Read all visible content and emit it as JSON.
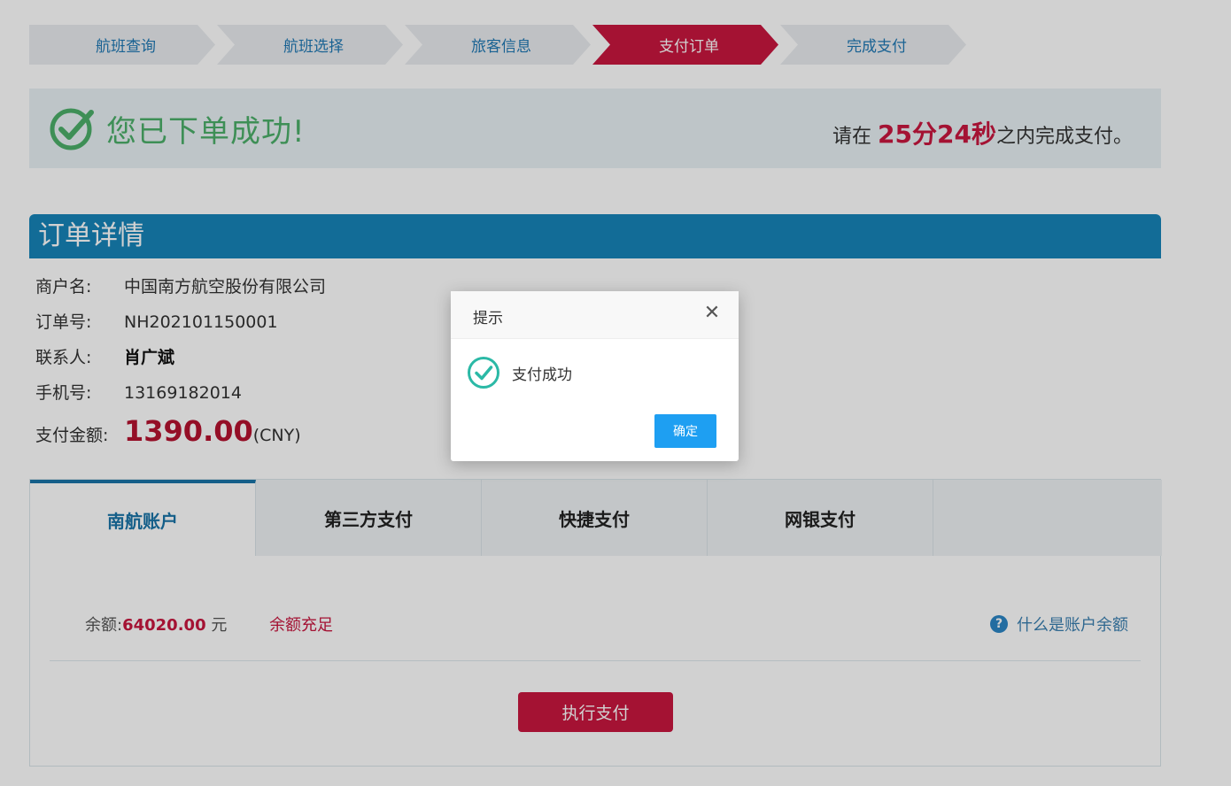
{
  "steps": [
    "航班查询",
    "航班选择",
    "旅客信息",
    "支付订单",
    "完成支付"
  ],
  "banner": {
    "success_text": "您已下单成功!",
    "countdown_prefix": "请在 ",
    "countdown_time": "25分24秒",
    "countdown_suffix": "之内完成支付。"
  },
  "order": {
    "header": "订单详情",
    "merchant_label": "商户名:",
    "merchant_value": "中国南方航空股份有限公司",
    "order_no_label": "订单号:",
    "order_no_value": "NH202101150001",
    "contact_label": "联系人:",
    "contact_value": "肖广斌",
    "phone_label": "手机号:",
    "phone_value": "13169182014",
    "amount_label": "支付金额:",
    "amount_value": "1390.00",
    "amount_currency": "(CNY)"
  },
  "payment": {
    "tabs": [
      "南航账户",
      "第三方支付",
      "快捷支付",
      "网银支付"
    ],
    "balance_label": "余额:",
    "balance_value": "64020.00",
    "balance_unit": " 元",
    "balance_status": "余额充足",
    "help_text": "什么是账户余额",
    "pay_button": "执行支付"
  },
  "dialog": {
    "title": "提示",
    "message": "支付成功",
    "confirm": "确定"
  },
  "colors": {
    "accent_red": "#c8163f",
    "header_blue": "#1784b9",
    "success_green": "#4caf6a",
    "dialog_button": "#1e9ff2"
  }
}
